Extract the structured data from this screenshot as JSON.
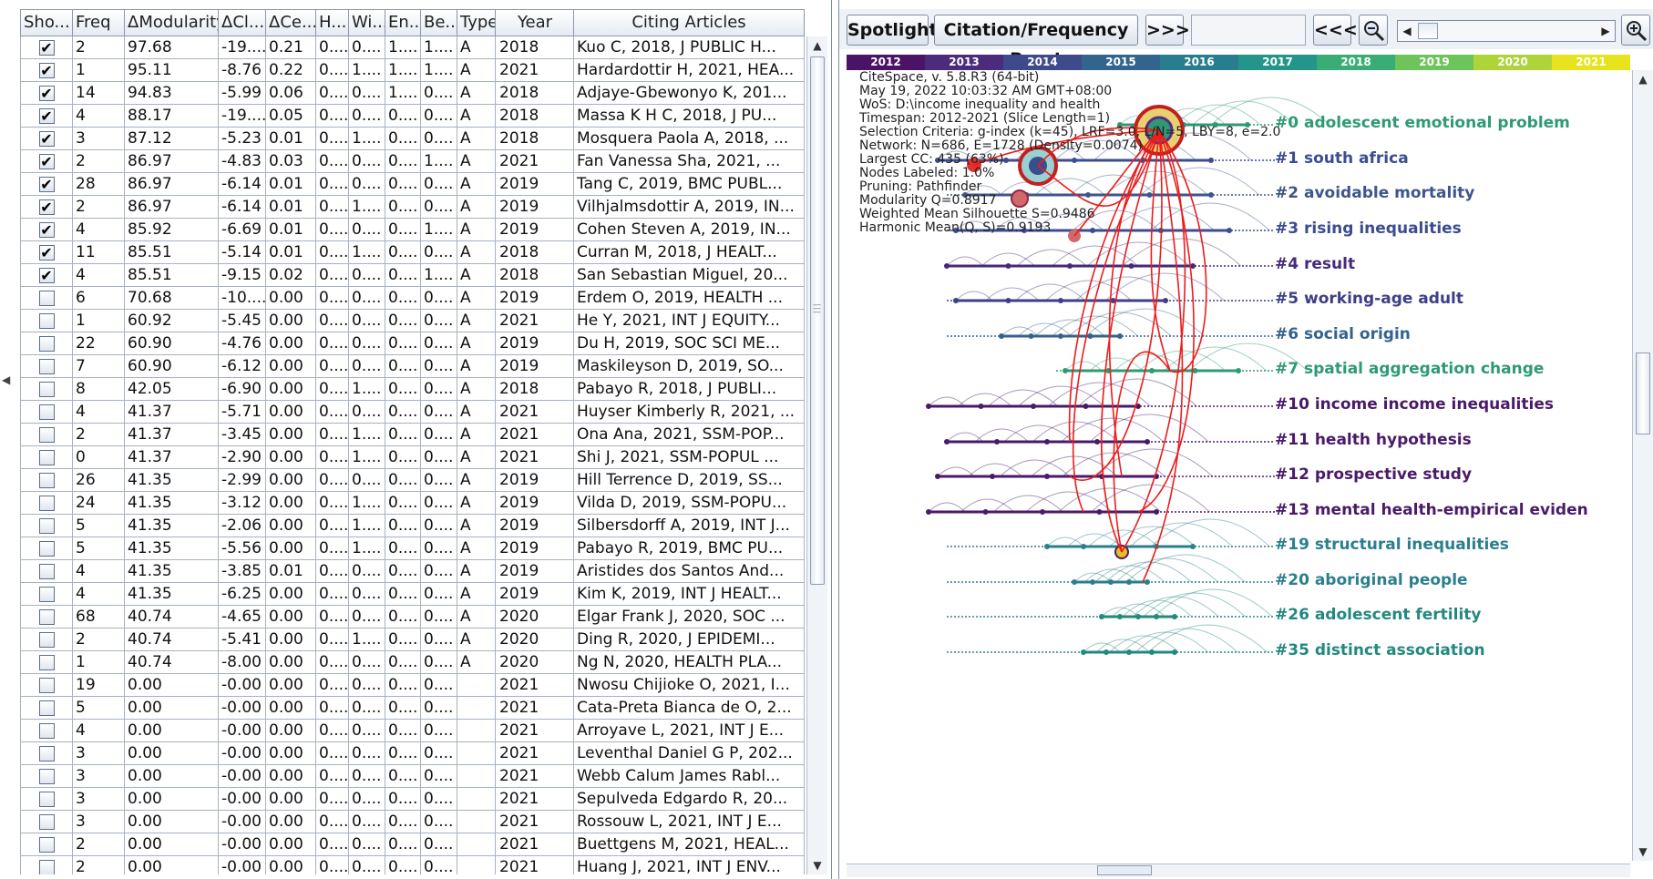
{
  "table": {
    "headers": [
      "Sho...",
      "Freq",
      "ΔModularity",
      "ΔCl...",
      "ΔCe...",
      "H...",
      "Wi...",
      "En...",
      "Be...",
      "Type",
      "Year",
      "Citing Articles"
    ],
    "rows": [
      {
        "checked": true,
        "freq": "2",
        "dmod": "97.68",
        "dcl": "-19....",
        "dce": "0.21",
        "h": "0....",
        "wi": "0....",
        "en": "1....",
        "be": "1....",
        "type": "A",
        "year": "2018",
        "cite": "Kuo C, 2018, J PUBLIC H..."
      },
      {
        "checked": true,
        "freq": "1",
        "dmod": "95.11",
        "dcl": "-8.76",
        "dce": "0.22",
        "h": "0....",
        "wi": "1....",
        "en": "1....",
        "be": "1....",
        "type": "A",
        "year": "2021",
        "cite": "Hardardottir H, 2021, HEA..."
      },
      {
        "checked": true,
        "freq": "14",
        "dmod": "94.83",
        "dcl": "-5.99",
        "dce": "0.06",
        "h": "0....",
        "wi": "0....",
        "en": "1....",
        "be": "0....",
        "type": "A",
        "year": "2018",
        "cite": "Adjaye-Gbewonyo K, 201..."
      },
      {
        "checked": true,
        "freq": "4",
        "dmod": "88.17",
        "dcl": "-19....",
        "dce": "0.05",
        "h": "0....",
        "wi": "0....",
        "en": "0....",
        "be": "0....",
        "type": "A",
        "year": "2018",
        "cite": "Massa K H C, 2018, J PU..."
      },
      {
        "checked": true,
        "freq": "3",
        "dmod": "87.12",
        "dcl": "-5.23",
        "dce": "0.01",
        "h": "0....",
        "wi": "1....",
        "en": "0....",
        "be": "0....",
        "type": "A",
        "year": "2018",
        "cite": "Mosquera Paola A, 2018, ..."
      },
      {
        "checked": true,
        "freq": "2",
        "dmod": "86.97",
        "dcl": "-4.83",
        "dce": "0.03",
        "h": "0....",
        "wi": "0....",
        "en": "0....",
        "be": "1....",
        "type": "A",
        "year": "2021",
        "cite": "Fan Vanessa Sha, 2021, ..."
      },
      {
        "checked": true,
        "freq": "28",
        "dmod": "86.97",
        "dcl": "-6.14",
        "dce": "0.01",
        "h": "0....",
        "wi": "0....",
        "en": "0....",
        "be": "0....",
        "type": "A",
        "year": "2019",
        "cite": "Tang C, 2019, BMC PUBL..."
      },
      {
        "checked": true,
        "freq": "2",
        "dmod": "86.97",
        "dcl": "-6.14",
        "dce": "0.01",
        "h": "0....",
        "wi": "1....",
        "en": "0....",
        "be": "0....",
        "type": "A",
        "year": "2019",
        "cite": "Vilhjalmsdottir A, 2019, IN..."
      },
      {
        "checked": true,
        "freq": "4",
        "dmod": "85.92",
        "dcl": "-6.69",
        "dce": "0.01",
        "h": "0....",
        "wi": "0....",
        "en": "0....",
        "be": "1....",
        "type": "A",
        "year": "2019",
        "cite": "Cohen Steven A, 2019, IN..."
      },
      {
        "checked": true,
        "freq": "11",
        "dmod": "85.51",
        "dcl": "-5.14",
        "dce": "0.01",
        "h": "0....",
        "wi": "1....",
        "en": "0....",
        "be": "0....",
        "type": "A",
        "year": "2018",
        "cite": "Curran M, 2018, J HEALT..."
      },
      {
        "checked": true,
        "freq": "4",
        "dmod": "85.51",
        "dcl": "-9.15",
        "dce": "0.02",
        "h": "0....",
        "wi": "0....",
        "en": "0....",
        "be": "1....",
        "type": "A",
        "year": "2018",
        "cite": "San Sebastian Miguel, 20..."
      },
      {
        "checked": false,
        "freq": "6",
        "dmod": "70.68",
        "dcl": "-10....",
        "dce": "0.00",
        "h": "0....",
        "wi": "0....",
        "en": "0....",
        "be": "0....",
        "type": "A",
        "year": "2019",
        "cite": "Erdem O, 2019, HEALTH ..."
      },
      {
        "checked": false,
        "freq": "1",
        "dmod": "60.92",
        "dcl": "-5.45",
        "dce": "0.00",
        "h": "0....",
        "wi": "0....",
        "en": "0....",
        "be": "0....",
        "type": "A",
        "year": "2021",
        "cite": "He Y, 2021, INT J EQUITY..."
      },
      {
        "checked": false,
        "freq": "22",
        "dmod": "60.90",
        "dcl": "-4.76",
        "dce": "0.00",
        "h": "0....",
        "wi": "0....",
        "en": "0....",
        "be": "0....",
        "type": "A",
        "year": "2019",
        "cite": "Du H, 2019, SOC SCI ME..."
      },
      {
        "checked": false,
        "freq": "7",
        "dmod": "60.90",
        "dcl": "-6.12",
        "dce": "0.00",
        "h": "0....",
        "wi": "0....",
        "en": "0....",
        "be": "0....",
        "type": "A",
        "year": "2019",
        "cite": "Maskileyson D, 2019, SO..."
      },
      {
        "checked": false,
        "freq": "8",
        "dmod": "42.05",
        "dcl": "-6.90",
        "dce": "0.00",
        "h": "0....",
        "wi": "1....",
        "en": "0....",
        "be": "0....",
        "type": "A",
        "year": "2018",
        "cite": "Pabayo R, 2018, J PUBLI..."
      },
      {
        "checked": false,
        "freq": "4",
        "dmod": "41.37",
        "dcl": "-5.71",
        "dce": "0.00",
        "h": "0....",
        "wi": "0....",
        "en": "0....",
        "be": "0....",
        "type": "A",
        "year": "2021",
        "cite": "Huyser Kimberly R, 2021, ..."
      },
      {
        "checked": false,
        "freq": "2",
        "dmod": "41.37",
        "dcl": "-3.45",
        "dce": "0.00",
        "h": "0....",
        "wi": "1....",
        "en": "0....",
        "be": "0....",
        "type": "A",
        "year": "2021",
        "cite": "Ona Ana, 2021, SSM-POP..."
      },
      {
        "checked": false,
        "freq": "0",
        "dmod": "41.37",
        "dcl": "-2.90",
        "dce": "0.00",
        "h": "0....",
        "wi": "1....",
        "en": "0....",
        "be": "0....",
        "type": "A",
        "year": "2021",
        "cite": "Shi J, 2021, SSM-POPUL ..."
      },
      {
        "checked": false,
        "freq": "26",
        "dmod": "41.35",
        "dcl": "-2.99",
        "dce": "0.00",
        "h": "0....",
        "wi": "0....",
        "en": "0....",
        "be": "0....",
        "type": "A",
        "year": "2019",
        "cite": "Hill Terrence D, 2019, SS..."
      },
      {
        "checked": false,
        "freq": "24",
        "dmod": "41.35",
        "dcl": "-3.12",
        "dce": "0.00",
        "h": "0....",
        "wi": "1....",
        "en": "0....",
        "be": "0....",
        "type": "A",
        "year": "2019",
        "cite": "Vilda D, 2019, SSM-POPU..."
      },
      {
        "checked": false,
        "freq": "5",
        "dmod": "41.35",
        "dcl": "-2.06",
        "dce": "0.00",
        "h": "0....",
        "wi": "1....",
        "en": "0....",
        "be": "0....",
        "type": "A",
        "year": "2019",
        "cite": "Silbersdorff A, 2019, INT J..."
      },
      {
        "checked": false,
        "freq": "5",
        "dmod": "41.35",
        "dcl": "-5.56",
        "dce": "0.00",
        "h": "0....",
        "wi": "1....",
        "en": "0....",
        "be": "0....",
        "type": "A",
        "year": "2019",
        "cite": "Pabayo R, 2019, BMC PU..."
      },
      {
        "checked": false,
        "freq": "4",
        "dmod": "41.35",
        "dcl": "-3.85",
        "dce": "0.01",
        "h": "0....",
        "wi": "0....",
        "en": "0....",
        "be": "0....",
        "type": "A",
        "year": "2019",
        "cite": "Aristides dos Santos And..."
      },
      {
        "checked": false,
        "freq": "4",
        "dmod": "41.35",
        "dcl": "-6.25",
        "dce": "0.00",
        "h": "0....",
        "wi": "0....",
        "en": "0....",
        "be": "0....",
        "type": "A",
        "year": "2019",
        "cite": "Kim K, 2019, INT J HEALT..."
      },
      {
        "checked": false,
        "freq": "68",
        "dmod": "40.74",
        "dcl": "-4.65",
        "dce": "0.00",
        "h": "0....",
        "wi": "0....",
        "en": "0....",
        "be": "0....",
        "type": "A",
        "year": "2020",
        "cite": "Elgar Frank J, 2020, SOC ..."
      },
      {
        "checked": false,
        "freq": "2",
        "dmod": "40.74",
        "dcl": "-5.41",
        "dce": "0.00",
        "h": "0....",
        "wi": "1....",
        "en": "0....",
        "be": "0....",
        "type": "A",
        "year": "2020",
        "cite": "Ding R, 2020, J EPIDEMI..."
      },
      {
        "checked": false,
        "freq": "1",
        "dmod": "40.74",
        "dcl": "-8.00",
        "dce": "0.00",
        "h": "0....",
        "wi": "0....",
        "en": "0....",
        "be": "0....",
        "type": "A",
        "year": "2020",
        "cite": "Ng N, 2020, HEALTH PLA..."
      },
      {
        "checked": false,
        "freq": "19",
        "dmod": "0.00",
        "dcl": "-0.00",
        "dce": "0.00",
        "h": "0....",
        "wi": "0....",
        "en": "0....",
        "be": "0....",
        "type": "",
        "year": "2021",
        "cite": "Nwosu Chijioke O, 2021, I..."
      },
      {
        "checked": false,
        "freq": "5",
        "dmod": "0.00",
        "dcl": "-0.00",
        "dce": "0.00",
        "h": "0....",
        "wi": "0....",
        "en": "0....",
        "be": "0....",
        "type": "",
        "year": "2021",
        "cite": "Cata-Preta Bianca de O, 2..."
      },
      {
        "checked": false,
        "freq": "4",
        "dmod": "0.00",
        "dcl": "-0.00",
        "dce": "0.00",
        "h": "0....",
        "wi": "0....",
        "en": "0....",
        "be": "0....",
        "type": "",
        "year": "2021",
        "cite": "Arroyave L, 2021, INT J E..."
      },
      {
        "checked": false,
        "freq": "3",
        "dmod": "0.00",
        "dcl": "-0.00",
        "dce": "0.00",
        "h": "0....",
        "wi": "0....",
        "en": "0....",
        "be": "0....",
        "type": "",
        "year": "2021",
        "cite": "Leventhal Daniel G P, 202..."
      },
      {
        "checked": false,
        "freq": "3",
        "dmod": "0.00",
        "dcl": "-0.00",
        "dce": "0.00",
        "h": "0....",
        "wi": "0....",
        "en": "0....",
        "be": "0....",
        "type": "",
        "year": "2021",
        "cite": "Webb Calum James Rabl..."
      },
      {
        "checked": false,
        "freq": "3",
        "dmod": "0.00",
        "dcl": "-0.00",
        "dce": "0.00",
        "h": "0....",
        "wi": "0....",
        "en": "0....",
        "be": "0....",
        "type": "",
        "year": "2021",
        "cite": "Sepulveda Edgardo R, 20..."
      },
      {
        "checked": false,
        "freq": "3",
        "dmod": "0.00",
        "dcl": "-0.00",
        "dce": "0.00",
        "h": "0....",
        "wi": "0....",
        "en": "0....",
        "be": "0....",
        "type": "",
        "year": "2021",
        "cite": "Rossouw L, 2021, INT J E..."
      },
      {
        "checked": false,
        "freq": "2",
        "dmod": "0.00",
        "dcl": "-0.00",
        "dce": "0.00",
        "h": "0....",
        "wi": "0....",
        "en": "0....",
        "be": "0....",
        "type": "",
        "year": "2021",
        "cite": "Buettgens M, 2021, HEAL..."
      },
      {
        "checked": false,
        "freq": "2",
        "dmod": "0.00",
        "dcl": "-0.00",
        "dce": "0.00",
        "h": "0....",
        "wi": "0....",
        "en": "0....",
        "be": "0....",
        "type": "",
        "year": "2021",
        "cite": "Huang J, 2021, INT J ENV..."
      }
    ]
  },
  "toolbar": {
    "spotlight_label": "Spotlight",
    "burst_label": "Citation/Frequency Burst",
    "forward_label": ">>>",
    "back_label": "<<<",
    "search_value": ""
  },
  "timeline": [
    {
      "year": "2012",
      "color": "#4a1366"
    },
    {
      "year": "2013",
      "color": "#4b2b7c"
    },
    {
      "year": "2014",
      "color": "#3d4a8c"
    },
    {
      "year": "2015",
      "color": "#32648e"
    },
    {
      "year": "2016",
      "color": "#287d8e"
    },
    {
      "year": "2017",
      "color": "#24958a"
    },
    {
      "year": "2018",
      "color": "#3aad76"
    },
    {
      "year": "2019",
      "color": "#6cc45a"
    },
    {
      "year": "2020",
      "color": "#aed43a"
    },
    {
      "year": "2021",
      "color": "#e7e31c"
    }
  ],
  "info_lines": [
    "CiteSpace, v. 5.8.R3 (64-bit)",
    "May 19, 2022 10:03:32 AM GMT+08:00",
    "WoS: D:\\income inequality and health",
    "Timespan: 2012-2021 (Slice Length=1)",
    "Selection Criteria: g-index (k=45), LRF=3.0, L/N=5, LBY=8, e=2.0",
    "Network: N=686, E=1728 (Density=0.0074)",
    "Largest CC: 435 (63%)",
    "Nodes Labeled: 1.0%",
    "Pruning: Pathfinder",
    "Modularity Q=0.8917",
    "Weighted Mean Silhouette S=0.9486",
    "Harmonic Mean(Q, S)=0.9193"
  ],
  "clusters": [
    {
      "label": "#0 adolescent emotional problem",
      "color": "#2e9a73"
    },
    {
      "label": "#1 south africa",
      "color": "#3a4d8f"
    },
    {
      "label": "#2 avoidable mortality",
      "color": "#3c568c"
    },
    {
      "label": "#3 rising inequalities",
      "color": "#3a4d8f"
    },
    {
      "label": "#4 result",
      "color": "#452a78"
    },
    {
      "label": "#5 working-age adult",
      "color": "#3d3f87"
    },
    {
      "label": "#6 social origin",
      "color": "#33628e"
    },
    {
      "label": "#7 spatial aggregation change",
      "color": "#2e9a73"
    },
    {
      "label": "#10 income income inequalities",
      "color": "#4a1a68"
    },
    {
      "label": "#11 health hypothesis",
      "color": "#4a1a68"
    },
    {
      "label": "#12 prospective study",
      "color": "#4a1a68"
    },
    {
      "label": "#13 mental health-empirical eviden",
      "color": "#4a1a68"
    },
    {
      "label": "#19 structural inequalities",
      "color": "#2b7f8d"
    },
    {
      "label": "#20 aboriginal people",
      "color": "#2b7f8d"
    },
    {
      "label": "#26 adolescent fertility",
      "color": "#23887f"
    },
    {
      "label": "#35 distinct association",
      "color": "#23887f"
    }
  ]
}
